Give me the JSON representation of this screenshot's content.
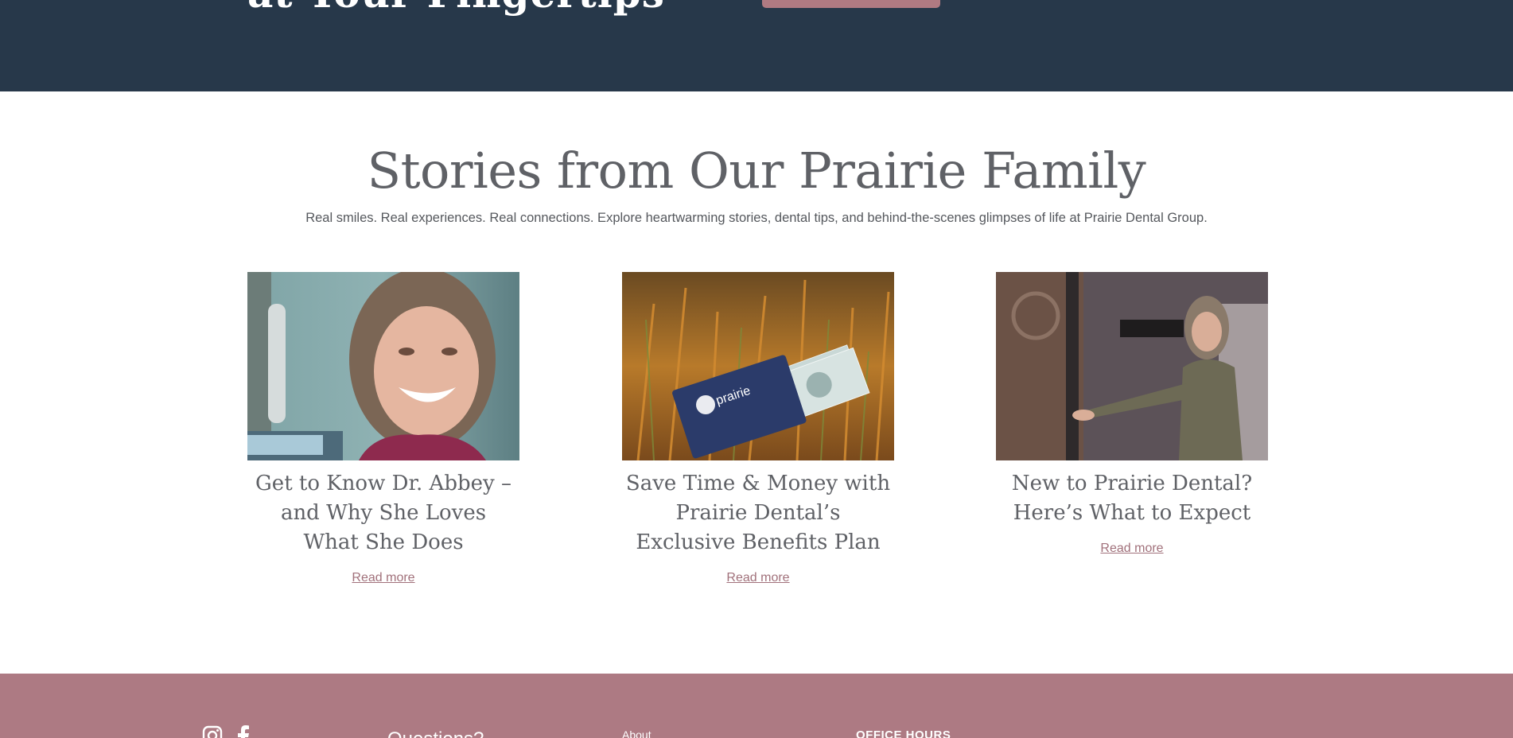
{
  "hero": {
    "title": "at Your Fingertips"
  },
  "stories": {
    "title": "Stories from Our Prairie Family",
    "subtitle": "Real smiles. Real experiences. Real connections. Explore heartwarming stories, dental tips, and behind-the-scenes glimpses of life at Prairie Dental Group.",
    "cards": [
      {
        "title": "Get to Know Dr. Abbey – and Why She Loves What She Does",
        "link": "Read more"
      },
      {
        "title": "Save Time & Money with Prairie Dental’s Exclusive Benefits Plan",
        "link": "Read more"
      },
      {
        "title": "New to Prairie Dental? Here’s What to Expect",
        "link": "Read more"
      }
    ],
    "card2_logo": "prairie"
  },
  "footer": {
    "question": "Questions?",
    "about": "About",
    "hours": "OFFICE HOURS"
  },
  "colors": {
    "navy": "#27384a",
    "rose": "#ad7a83",
    "heading": "#5f6166"
  },
  "icons": [
    "instagram-icon",
    "facebook-icon"
  ]
}
